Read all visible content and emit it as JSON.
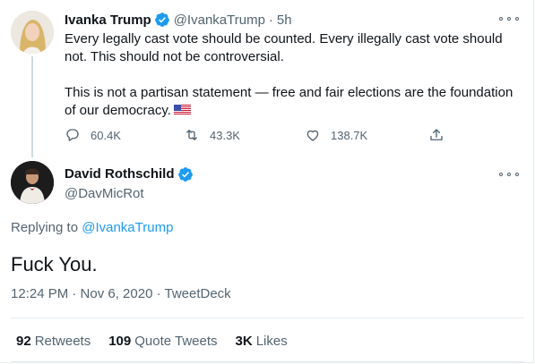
{
  "parent_tweet": {
    "author_name": "Ivanka Trump",
    "author_handle": "@IvankaTrump",
    "separator": "·",
    "time": "5h",
    "paragraphs": [
      "Every legally cast vote should be counted. Every illegally cast vote should not. This should not be controversial.",
      "This is not a partisan statement — free and fair elections are the foundation of our democracy."
    ],
    "flag_icon": "us-flag-icon",
    "reply_count": "60.4K",
    "retweet_count": "43.3K",
    "like_count": "138.7K"
  },
  "main_tweet": {
    "author_name": "David Rothschild",
    "author_handle": "@DavMicRot",
    "replying_prefix": "Replying to",
    "replying_to": "@IvankaTrump",
    "text": "Fuck You.",
    "timestamp": "12:24 PM · Nov 6, 2020 · TweetDeck",
    "stats": {
      "retweets_count": "92",
      "retweets_label": "Retweets",
      "quotes_count": "109",
      "quotes_label": "Quote Tweets",
      "likes_count": "3K",
      "likes_label": "Likes"
    }
  },
  "colors": {
    "verified": "#1d9bf0",
    "link": "#1d9bf0",
    "secondary_text": "#536471"
  }
}
